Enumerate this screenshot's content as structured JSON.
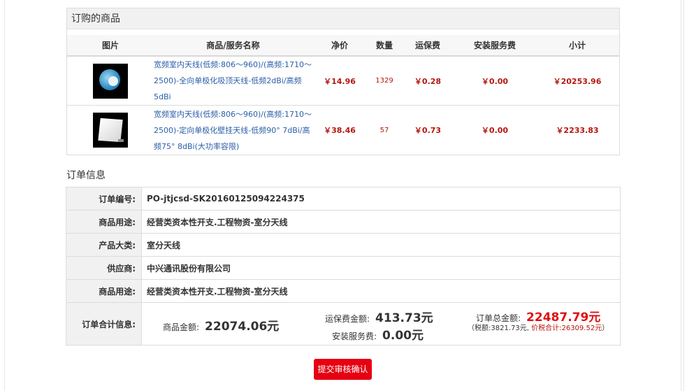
{
  "products": {
    "title": "订购的商品",
    "headers": {
      "image": "图片",
      "name": "商品/服务名称",
      "price": "净价",
      "qty": "数量",
      "shipping": "运保费",
      "install": "安装服务费",
      "subtotal": "小计"
    },
    "rows": [
      {
        "image_icon": "ceiling-antenna-image",
        "name": "宽频室内天线(低频:806～960)/(高频:1710～2500)-全向单极化吸顶天线-低频2dBi/高频5dBi",
        "price": "￥14.96",
        "qty": "1329",
        "shipping": "￥0.28",
        "install": "￥0.00",
        "subtotal": "￥20253.96"
      },
      {
        "image_icon": "panel-antenna-image",
        "name": "宽频室内天线(低频:806～960)/(高频:1710～2500)-定向单极化壁挂天线-低频90° 7dBi/高频75° 8dBi(大功率容限)",
        "price": "￥38.46",
        "qty": "57",
        "shipping": "￥0.73",
        "install": "￥0.00",
        "subtotal": "￥2233.83"
      }
    ]
  },
  "order": {
    "heading": "订单信息",
    "fields": [
      {
        "label": "订单编号:",
        "value": "PO-jtjcsd-SK20160125094224375"
      },
      {
        "label": "商品用途:",
        "value": "经营类资本性开支.工程物资-室分天线"
      },
      {
        "label": "产品大类:",
        "value": "室分天线"
      },
      {
        "label": "供应商:",
        "value": "中兴通讯股份有限公司"
      },
      {
        "label": "商品用途:",
        "value": "经营类资本性开支.工程物资-室分天线"
      }
    ],
    "totals": {
      "label": "订单合计信息:",
      "goods_label": "商品金额:",
      "goods_value": "22074.06元",
      "shipping_label": "运保费金额:",
      "shipping_value": "413.73元",
      "install_label": "安装服务费:",
      "install_value": "0.00元",
      "total_label": "订单总金额:",
      "total_value": "22487.79元",
      "tax_prefix": "（税额:",
      "tax_value": "3821.73元,",
      "with_tax_label": "价税合计:",
      "with_tax_value": "26309.52",
      "with_tax_unit": "元",
      "tax_suffix": "）"
    }
  },
  "actions": {
    "submit_label": "提交审核确认"
  },
  "colors": {
    "price_red": "#b3170f",
    "total_red": "#e01010",
    "button_red": "#e60012",
    "link_blue": "#2a5ea8",
    "header_gray": "#f1f1f1"
  }
}
